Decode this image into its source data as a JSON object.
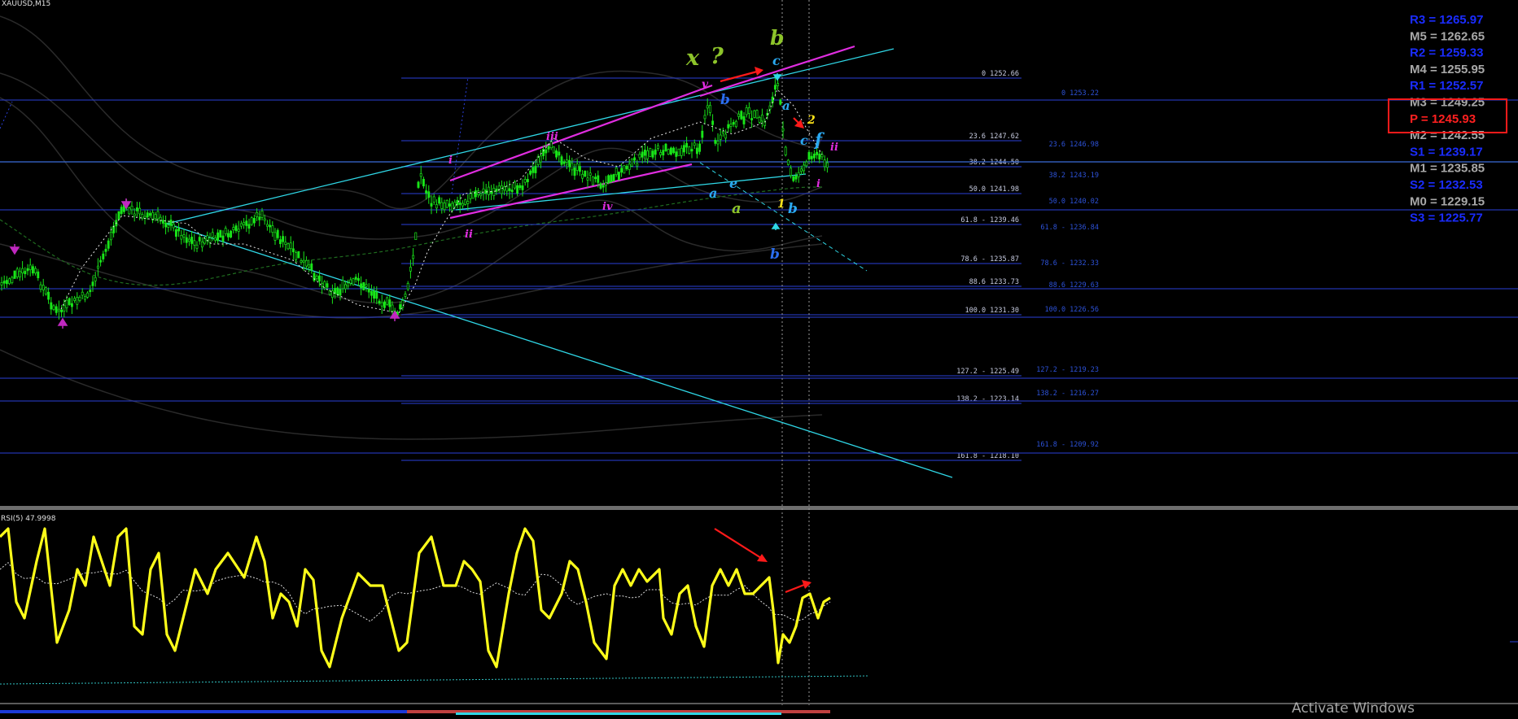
{
  "window": {
    "symbol_title": "XAUUSD,M15"
  },
  "indicator": {
    "title": "RSI(5) 47.9998"
  },
  "watermark": {
    "text": "Activate Windows"
  },
  "colors": {
    "background": "#000000",
    "candle": "#19e619",
    "fib_line": "#2a3fd8",
    "trend_cyan": "#2fd7e6",
    "channel_magenta": "#e02de0",
    "rsi": "#ffff1a",
    "pivot_blue": "#1a2cff",
    "pivot_gray": "#a8a8a8",
    "pivot_highlight": "#ff2020"
  },
  "fib_levels": [
    {
      "label": "0 1252.66",
      "ghost": "0 1253.22"
    },
    {
      "label": "23.6 1247.62",
      "ghost": "23.6 1246.98"
    },
    {
      "label": "38.2 1244.50",
      "ghost": "38.2 1243.19"
    },
    {
      "label": "50.0 1241.98",
      "ghost": "50.0 1240.02"
    },
    {
      "label": "61.8 - 1239.46",
      "ghost": "61.8 - 1236.84"
    },
    {
      "label": "78.6 - 1235.87",
      "ghost": "78.6 - 1232.33"
    },
    {
      "label": "88.6 1233.73",
      "ghost": "88.6 1229.63"
    },
    {
      "label": "100.0 1231.30",
      "ghost": "100.0 1226.56"
    },
    {
      "label": "127.2 - 1225.49",
      "ghost": "127.2 - 1219.23"
    },
    {
      "label": "138.2 - 1223.14",
      "ghost": "138.2 - 1216.27"
    },
    {
      "label": "161.8 - 1218.10",
      "ghost": "161.8 - 1209.92"
    }
  ],
  "pivots": [
    {
      "label": "R3 = 1265.97",
      "color": "#1a2cff"
    },
    {
      "label": "M5 = 1262.65",
      "color": "#a8a8a8"
    },
    {
      "label": "R2 = 1259.33",
      "color": "#1a2cff"
    },
    {
      "label": "M4 = 1255.95",
      "color": "#a8a8a8"
    },
    {
      "label": "R1 = 1252.57",
      "color": "#1a2cff"
    },
    {
      "label": "M3 = 1249.25",
      "color": "#a8a8a8"
    },
    {
      "label": "P   = 1245.93",
      "color": "#ff2020"
    },
    {
      "label": "M2 = 1242.55",
      "color": "#a8a8a8"
    },
    {
      "label": "S1 = 1239.17",
      "color": "#1a2cff"
    },
    {
      "label": "M1 = 1235.85",
      "color": "#a8a8a8"
    },
    {
      "label": "S2 = 1232.53",
      "color": "#1a2cff"
    },
    {
      "label": "M0 = 1229.15",
      "color": "#a8a8a8"
    },
    {
      "label": "S3 = 1225.77",
      "color": "#1a2cff"
    }
  ],
  "wave_labels": {
    "x": "x",
    "q": "?",
    "b_top": "b",
    "c_top": "c",
    "v": "v",
    "b_blue": "b",
    "a_blue": "a",
    "two": "2",
    "c_blue": "c",
    "f": "f",
    "ii_right": "ii",
    "i_right": "i",
    "one": "1",
    "b_blue2": "b",
    "b_bottom": "b",
    "e": "e",
    "a_low": "a",
    "a_green": "a",
    "iii": "iii",
    "iv": "iv",
    "ii_left": "ii",
    "i_left": "i"
  }
}
